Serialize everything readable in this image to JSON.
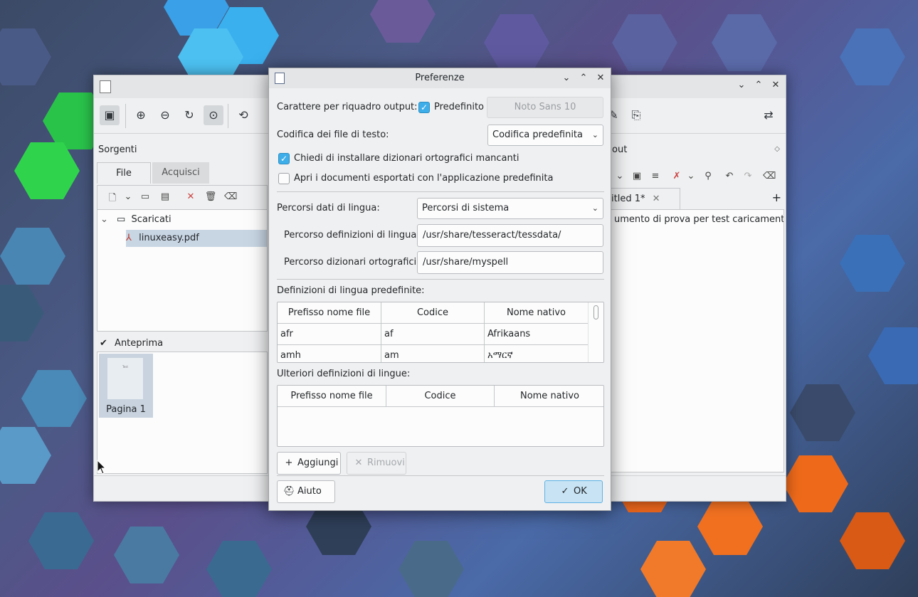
{
  "main_window": {
    "left_panel": {
      "title": "Sorgenti",
      "tabs": [
        "File",
        "Acquisci"
      ],
      "tree": {
        "folder": "Scaricati",
        "file": "linuxeasy.pdf"
      },
      "preview_label": "Anteprima",
      "thumbnail_caption": "Pagina 1",
      "thumbnail_text": "Test"
    },
    "right_panel": {
      "title": "out",
      "doc_tab": "itled 1*",
      "editor_text": "umento di prova per test caricamento"
    }
  },
  "dialog": {
    "title": "Preferenze",
    "output_font_label": "Carattere per riquadro output:",
    "default_checkbox_label": "Predefinito",
    "default_checked": true,
    "font_button": "Noto Sans 10",
    "text_encoding_label": "Codifica dei file di testo:",
    "text_encoding_value": "Codifica predefinita",
    "ask_install_dicts_label": "Chiedi di installare dizionari ortografici mancanti",
    "ask_install_dicts_checked": true,
    "open_exported_label": "Apri i documenti esportati con l'applicazione predefinita",
    "open_exported_checked": false,
    "lang_paths_label": "Percorsi dati di lingua:",
    "lang_paths_value": "Percorsi di sistema",
    "lang_def_path_label": "Percorso definizioni di lingua:",
    "lang_def_path_value": "/usr/share/tesseract/tessdata/",
    "spell_path_label": "Percorso dizionari ortografici:",
    "spell_path_value": "/usr/share/myspell",
    "predefined_defs_label": "Definizioni di lingua predefinite:",
    "table_headers": [
      "Prefisso nome file",
      "Codice",
      "Nome nativo"
    ],
    "predefined_rows": [
      [
        "afr",
        "af",
        "Afrikaans"
      ],
      [
        "amh",
        "am",
        "አማርኛ"
      ]
    ],
    "additional_defs_label": "Ulteriori definizioni di lingue:",
    "add_button": "Aggiungi",
    "remove_button": "Rimuovi",
    "help_button": "Aiuto",
    "ok_button": "OK",
    "accent_color": "#3daee9"
  }
}
